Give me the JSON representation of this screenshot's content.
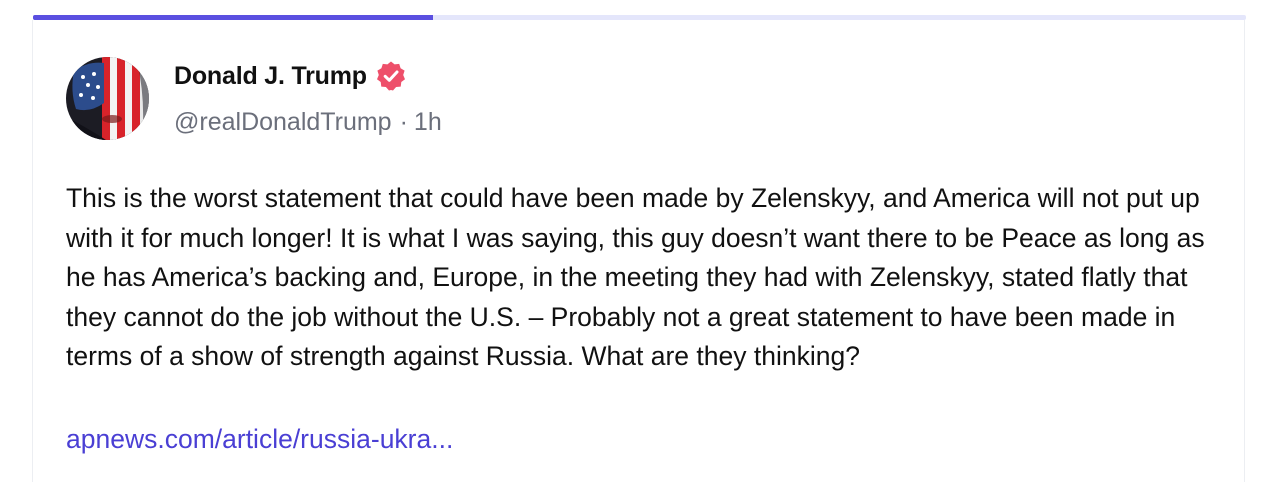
{
  "progress": {
    "fraction": 0.33,
    "fill_color": "#5a4fe0",
    "track_color": "#e4e6fb"
  },
  "post": {
    "author": {
      "display_name": "Donald J. Trump",
      "verified": true,
      "verified_icon": "verified-badge-icon",
      "verified_color": "#ee4f6a",
      "handle": "@realDonaldTrump",
      "separator": "·",
      "timestamp": "1h"
    },
    "body": "This is the worst statement that could have been made by Zelenskyy, and America will not put up with it for much longer! It is what I was saying, this guy doesn’t want there to be Peace as long as he has America’s backing and, Europe, in the meeting they had with Zelenskyy, stated flatly that they cannot do the job without the U.S. – Probably not a great statement to have been made in terms of a show of strength against Russia. What are they thinking?",
    "link_text": "apnews.com/article/russia-ukra...",
    "link_color": "#4a3fd4"
  }
}
